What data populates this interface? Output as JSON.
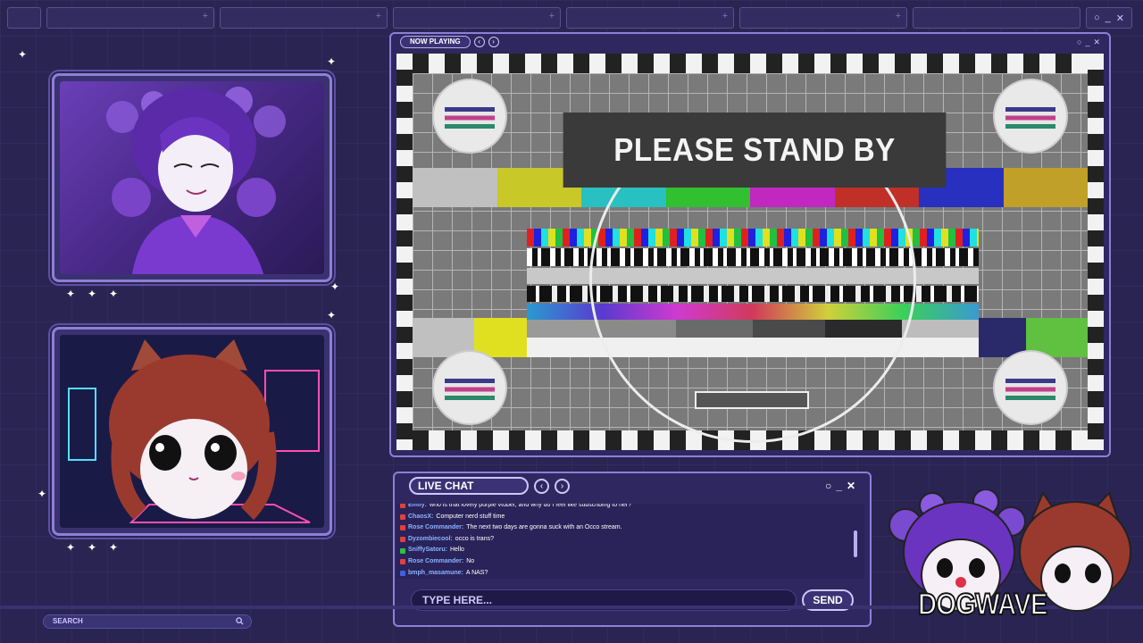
{
  "tabs": [
    {
      "plus": "+"
    },
    {
      "plus": "+"
    },
    {
      "plus": "+"
    },
    {
      "plus": "+"
    },
    {
      "plus": "+"
    }
  ],
  "window_controls": {
    "minimize": "_",
    "maximize": "○",
    "close": "✕"
  },
  "player": {
    "now_playing_label": "NOW PLAYING",
    "prev": "‹",
    "next": "›",
    "standby_text": "PLEASE STAND BY"
  },
  "colors": {
    "accent": "#8e7fd6",
    "background": "#2a2452",
    "panel": "#2f2860"
  },
  "colorbars_top": [
    "#c0c0c0",
    "#c8c828",
    "#28c0c0",
    "#30c030",
    "#c028c0",
    "#c03028",
    "#2830c0",
    "#c0a028"
  ],
  "colorbars_bottom": [
    "#c0c0c0",
    "#e0e020",
    "#20e0e0",
    "#20c020",
    "#e020e0",
    "#e05020",
    "#2090e0",
    "#b0a0a0",
    "#e0b030",
    "#2a2a6a",
    "#60c040"
  ],
  "chat": {
    "title": "LIVE CHAT",
    "prev": "‹",
    "next": "›",
    "input_placeholder": "TYPE HERE...",
    "send_label": "SEND",
    "messages": [
      {
        "user": "Emily",
        "text": "who is that lovely purple vtuber, and why do I feel like subscribing to her?",
        "color": "#8ab4ff",
        "badge": "#e04040"
      },
      {
        "user": "ChaosX",
        "text": "Computer nerd stuff time",
        "color": "#8ab4ff",
        "badge": "#e04040"
      },
      {
        "user": "Rose Commander",
        "text": "The next two days are gonna suck with an Occo stream.",
        "color": "#8ab4ff",
        "badge": "#e04040"
      },
      {
        "user": "Dyzombiecool",
        "text": "occo is trans?",
        "color": "#8ab4ff",
        "badge": "#e04040"
      },
      {
        "user": "SniffySatoru",
        "text": "Hello",
        "color": "#8ab4ff",
        "badge": "#30c040"
      },
      {
        "user": "Rose Commander",
        "text": "No",
        "color": "#8ab4ff",
        "badge": "#e04040"
      },
      {
        "user": "bmph_masamune",
        "text": "A NAS?",
        "color": "#8ab4ff",
        "badge": "#4060e0"
      }
    ]
  },
  "search": {
    "placeholder": "SEARCH"
  },
  "logo": {
    "text": "DOGWAVE"
  }
}
